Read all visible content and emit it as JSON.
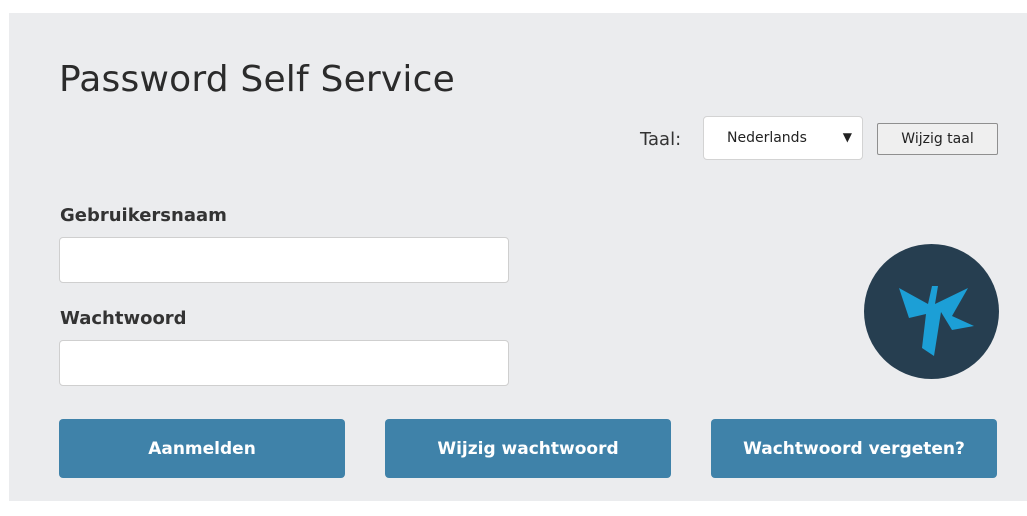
{
  "header": {
    "title": "Password Self Service"
  },
  "language": {
    "label": "Taal:",
    "selected": "Nederlands",
    "change_button": "Wijzig taal"
  },
  "form": {
    "username_label": "Gebruikersnaam",
    "username_value": "",
    "password_label": "Wachtwoord",
    "password_value": ""
  },
  "logo": {
    "icon": "pss-logo-icon",
    "bg_color": "#263e50",
    "mark_color": "#1c9fd6"
  },
  "actions": {
    "login": "Aanmelden",
    "change_password": "Wijzig wachtwoord",
    "forgot_password": "Wachtwoord vergeten?"
  },
  "colors": {
    "button": "#3f82a9",
    "panel": "#ebecee"
  }
}
